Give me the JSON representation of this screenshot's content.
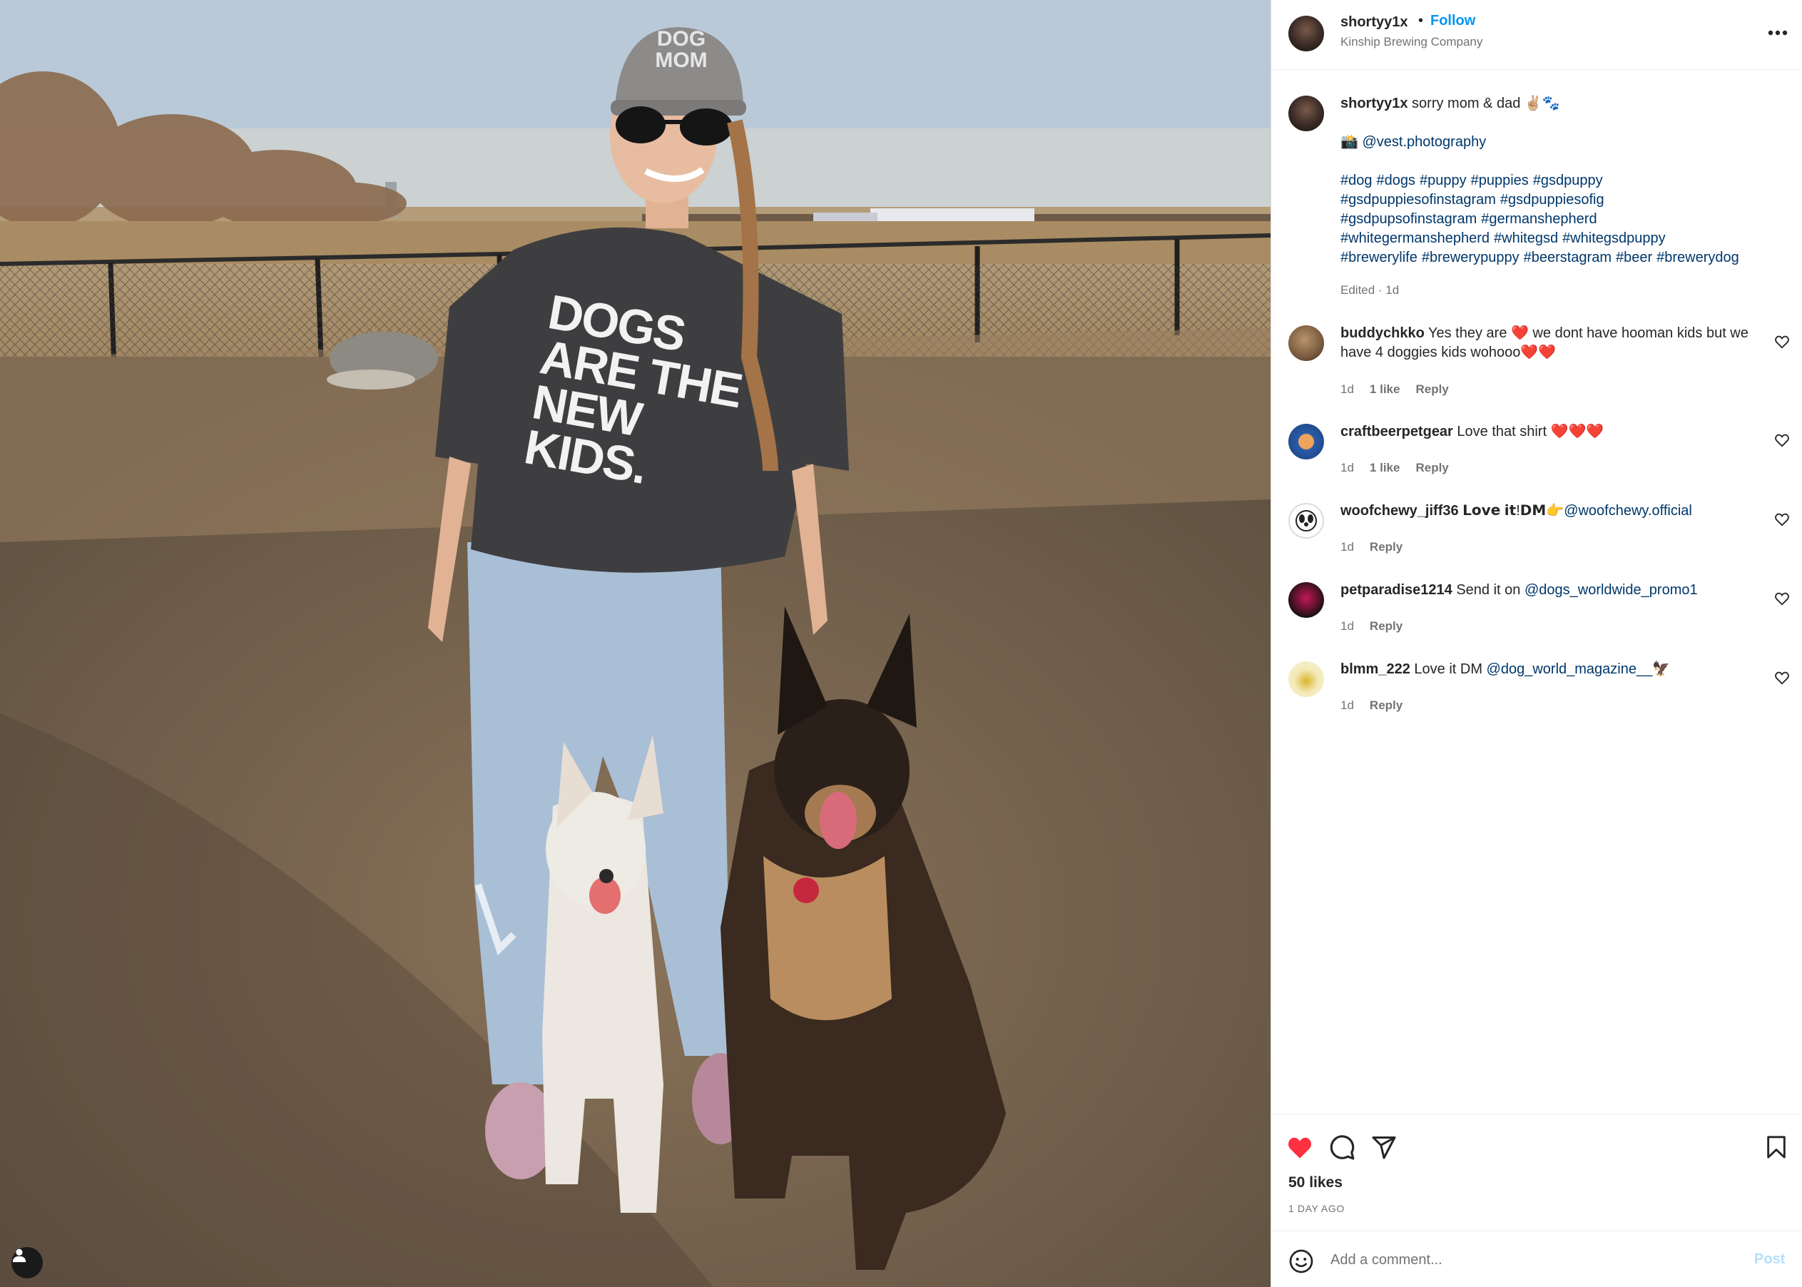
{
  "post": {
    "author": "shortyy1x",
    "follow_label": "Follow",
    "separator": "•",
    "location": "Kinship Brewing Company",
    "more_label": "•••",
    "photo_tag_icon": "user-tag-icon"
  },
  "photo": {
    "cap_text": [
      "DOG",
      "MOM"
    ],
    "shirt_text": [
      "DOGS",
      "ARE THE",
      "NEW",
      "KIDS."
    ]
  },
  "caption": {
    "username": "shortyy1x",
    "text": " sorry mom & dad ✌🏼🐾",
    "credit_icon": "📸",
    "credit_mention": "@vest.photography",
    "hashtags": [
      "#dog",
      "#dogs",
      "#puppy",
      "#puppies",
      "#gsdpuppy",
      "#gsdpuppiesofinstagram",
      "#gsdpuppiesofig",
      "#gsdpupsofinstagram",
      "#germanshepherd",
      "#whitegermanshepherd",
      "#whitegsd",
      "#whitegsdpuppy",
      "#brewerylife",
      "#brewerypuppy",
      "#beerstagram",
      "#beer",
      "#brewerydog"
    ],
    "edited": "Edited · 1d"
  },
  "comments": [
    {
      "username": "buddychkko",
      "text_before": " Yes they are ❤️ we dont have hooman kids but we have 4 doggies kids wohooo❤️❤️",
      "mention": "",
      "text_after": "",
      "time": "1d",
      "likes": "1 like",
      "reply": "Reply",
      "avatar_color": "#8a6a4a"
    },
    {
      "username": "craftbeerpetgear",
      "text_before": " Love that shirt ❤️❤️❤️",
      "mention": "",
      "text_after": "",
      "time": "1d",
      "likes": "1 like",
      "reply": "Reply",
      "avatar_color": "#2a5ca8"
    },
    {
      "username": "woofchewy_jiff36",
      "text_before": " 𝗟𝗼𝘃𝗲 𝗶𝘁!𝗗𝗠👉",
      "mention": "@woofchewy.official",
      "text_after": "",
      "time": "1d",
      "likes": "",
      "reply": "Reply",
      "avatar_color": "#ffffff"
    },
    {
      "username": "petparadise1214",
      "text_before": " Send it on ",
      "mention": "@dogs_worldwide_promo1",
      "text_after": "",
      "time": "1d",
      "likes": "",
      "reply": "Reply",
      "avatar_color": "#1a1a1a"
    },
    {
      "username": "blmm_222",
      "text_before": " Love it DM ",
      "mention": "@dog_world_magazine__",
      "text_after": "🦅",
      "time": "1d",
      "likes": "",
      "reply": "Reply",
      "avatar_color": "#f3e9b8"
    }
  ],
  "actions": {
    "like_icon": "heart-filled-icon",
    "comment_icon": "comment-bubble-icon",
    "share_icon": "paper-plane-icon",
    "save_icon": "bookmark-icon",
    "like_color": "#ff3040",
    "likes": "50 likes",
    "posted": "1 DAY AGO"
  },
  "add_comment": {
    "emoji_icon": "smiley-icon",
    "placeholder": "Add a comment...",
    "post_label": "Post",
    "post_color": "#b2dffc"
  }
}
